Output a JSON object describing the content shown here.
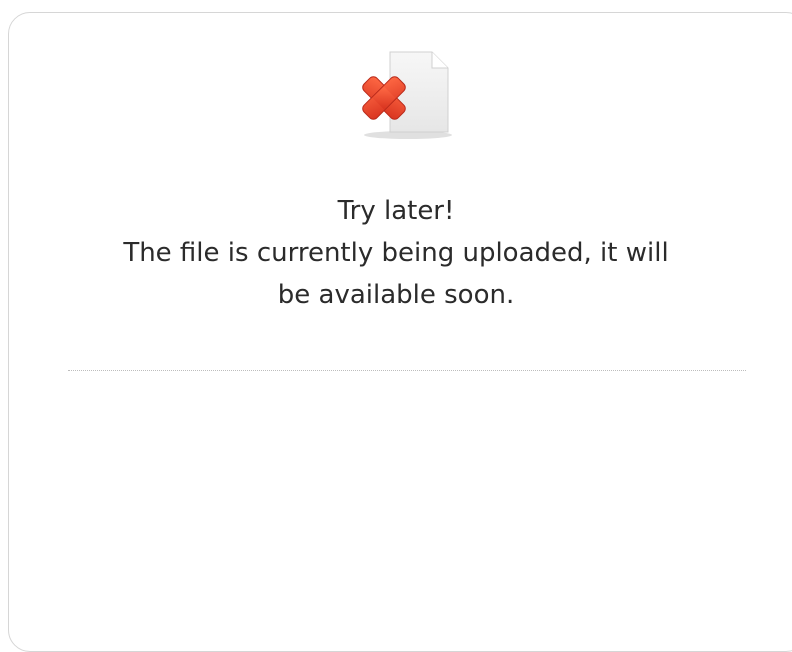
{
  "status_icon": {
    "name": "file-error-icon"
  },
  "message": {
    "title": "Try later!",
    "line1": "The file is currently being uploaded, it will",
    "line2": "be available soon."
  },
  "colors": {
    "border": "#d6d6d6",
    "text": "#2b2b2b",
    "x_mark": "#e8472a",
    "divider": "#bdbdbd"
  }
}
